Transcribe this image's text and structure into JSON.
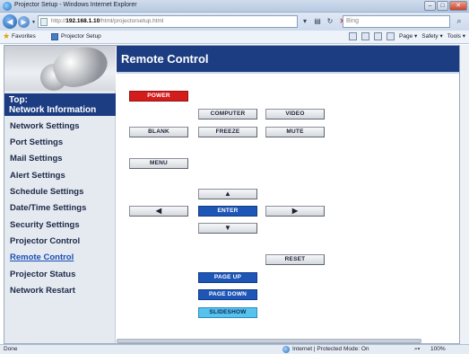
{
  "window": {
    "title": "Projector Setup - Windows Internet Explorer",
    "controls": {
      "minimize": "–",
      "maximize": "□",
      "close": "✕"
    }
  },
  "address_bar": {
    "url_prefix": "http://",
    "url_host": "192.168.1.10",
    "url_path": "/html/projectorsetup.html",
    "search_placeholder": "Bing"
  },
  "favorites_bar": {
    "favorites_label": "Favorites",
    "tab_label": "Projector Setup",
    "commands": [
      "Page ▾",
      "Safety ▾",
      "Tools ▾"
    ]
  },
  "sidebar": {
    "top_label_line1": "Top:",
    "top_label_line2": "Network Information",
    "items": [
      {
        "label": "Network Settings"
      },
      {
        "label": "Port Settings"
      },
      {
        "label": "Mail Settings"
      },
      {
        "label": "Alert Settings"
      },
      {
        "label": "Schedule Settings"
      },
      {
        "label": "Date/Time Settings"
      },
      {
        "label": "Security Settings"
      },
      {
        "label": "Projector Control"
      },
      {
        "label": "Remote Control"
      },
      {
        "label": "Projector Status"
      },
      {
        "label": "Network Restart"
      }
    ],
    "active_item": "Remote Control"
  },
  "main": {
    "title": "Remote Control",
    "buttons": {
      "power": "POWER",
      "computer": "COMPUTER",
      "video": "VIDEO",
      "blank": "BLANK",
      "freeze": "FREEZE",
      "mute": "MUTE",
      "menu": "MENU",
      "up": "▲",
      "left": "◀",
      "enter": "ENTER",
      "right": "▶",
      "down": "▼",
      "reset": "RESET",
      "page_up": "PAGE UP",
      "page_down": "PAGE DOWN",
      "slideshow": "SLIDESHOW"
    }
  },
  "status_bar": {
    "status": "Done",
    "zone": "Internet | Protected Mode: On",
    "zoom": "100%"
  },
  "colors": {
    "header_blue": "#1c3d82",
    "power_red": "#d31c1c",
    "enter_blue": "#1e56b8",
    "slideshow_cyan": "#57c2eb"
  }
}
